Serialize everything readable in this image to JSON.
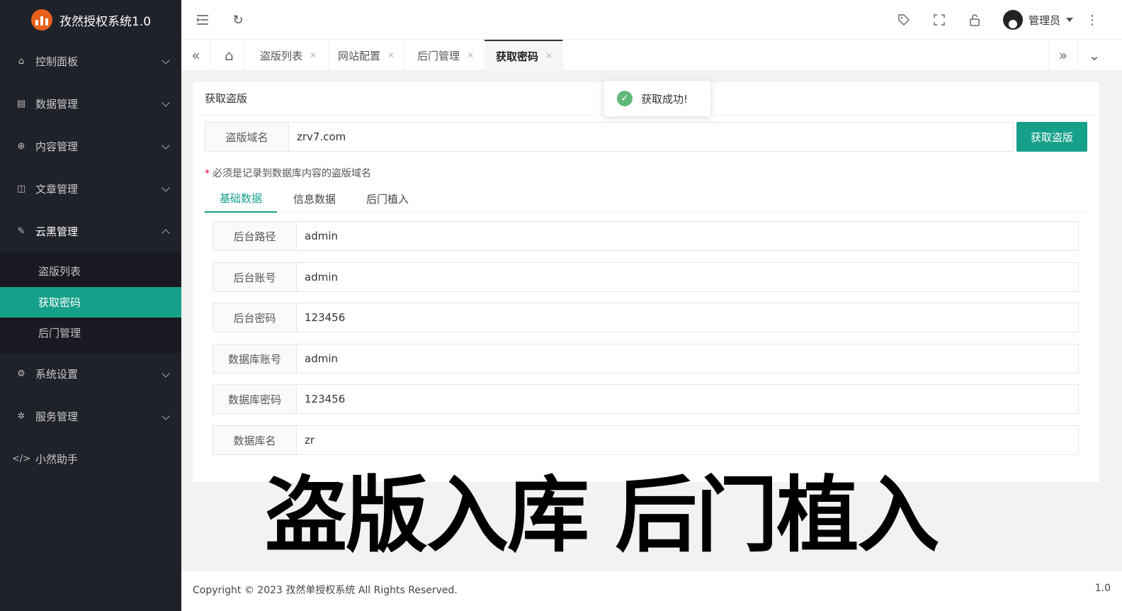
{
  "app": {
    "title": "孜然授权系统1.0"
  },
  "sidebar": {
    "items": [
      {
        "label": "控制面板"
      },
      {
        "label": "数据管理"
      },
      {
        "label": "内容管理"
      },
      {
        "label": "文章管理"
      },
      {
        "label": "云黑管理"
      },
      {
        "label": "系统设置"
      },
      {
        "label": "服务管理"
      },
      {
        "label": "小然助手"
      }
    ],
    "sub_items": [
      {
        "label": "盗版列表"
      },
      {
        "label": "获取密码"
      },
      {
        "label": "后门管理"
      }
    ]
  },
  "header": {
    "user_name": "管理员"
  },
  "tabs": [
    {
      "label": "盗版列表"
    },
    {
      "label": "网站配置"
    },
    {
      "label": "后门管理"
    },
    {
      "label": "获取密码"
    }
  ],
  "card": {
    "title": "获取盗版",
    "domain_label": "盗版域名",
    "domain_value": "zrv7.com",
    "get_button": "获取盗版",
    "hint": "必须是记录到数据库内容的盗版域名",
    "sub_tabs": [
      {
        "label": "基础数据"
      },
      {
        "label": "信息数据"
      },
      {
        "label": "后门植入"
      }
    ],
    "fields": [
      {
        "label": "后台路径",
        "value": "admin"
      },
      {
        "label": "后台账号",
        "value": "admin"
      },
      {
        "label": "后台密码",
        "value": "123456"
      },
      {
        "label": "数据库账号",
        "value": "admin"
      },
      {
        "label": "数据库密码",
        "value": "123456"
      },
      {
        "label": "数据库名",
        "value": "zr"
      }
    ]
  },
  "toast": {
    "message": "获取成功!"
  },
  "overlay_caption": "盗版入库 后门植入",
  "footer": {
    "copyright": "Copyright © 2023 孜然单授权系统 All Rights Reserved.",
    "version": "1.0"
  },
  "colors": {
    "accent": "#16a08a",
    "sidebar_bg": "#20222a",
    "logo": "#e8601c"
  }
}
